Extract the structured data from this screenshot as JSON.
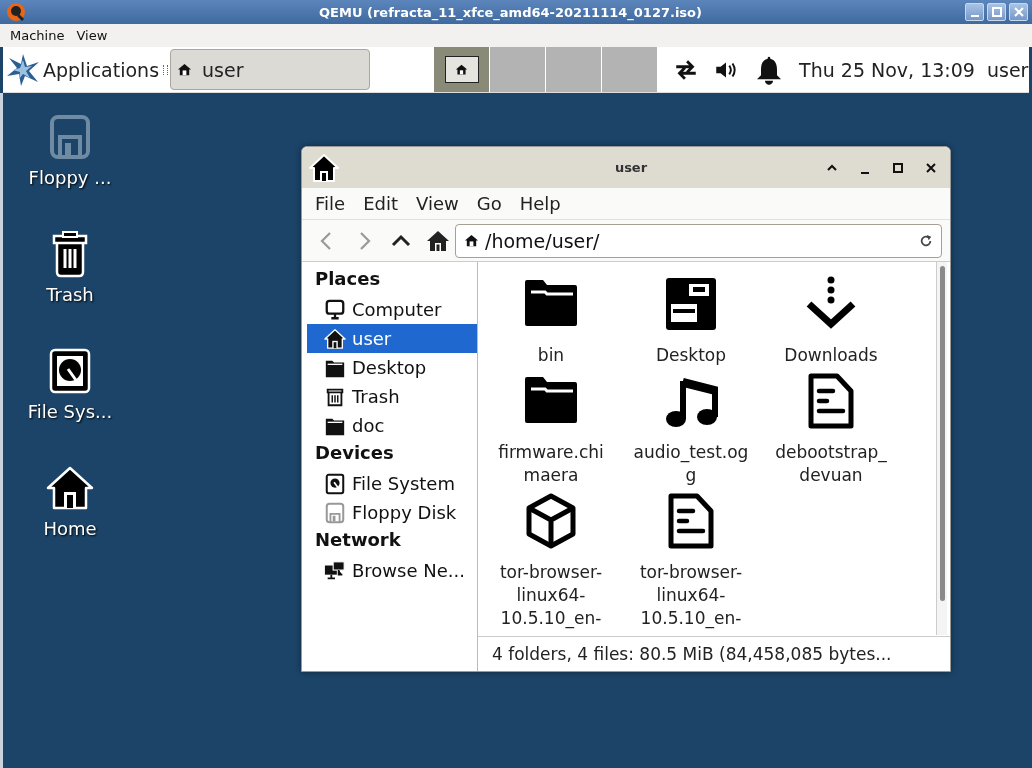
{
  "window": {
    "title": "QEMU (refracta_11_xfce_amd64-20211114_0127.iso)"
  },
  "menu": [
    "Machine",
    "View"
  ],
  "panel": {
    "applications": "Applications",
    "task": {
      "label": "user"
    },
    "workspaces": [
      {
        "selected": true
      },
      {
        "selected": false
      },
      {
        "selected": false
      },
      {
        "selected": false
      }
    ],
    "clock": "Thu 25 Nov, 13:09",
    "user": "user"
  },
  "desktop_icons": [
    {
      "kind": "floppy",
      "label": "Floppy ..."
    },
    {
      "kind": "trash",
      "label": "Trash"
    },
    {
      "kind": "drive",
      "label": "File Sys..."
    },
    {
      "kind": "home",
      "label": "Home"
    }
  ],
  "file_manager": {
    "title": "user",
    "menu": [
      "File",
      "Edit",
      "View",
      "Go",
      "Help"
    ],
    "location": "/home/user/",
    "sidebar": [
      {
        "heading": "Places",
        "items": [
          {
            "kind": "computer",
            "label": "Computer",
            "selected": false
          },
          {
            "kind": "home",
            "label": "user",
            "selected": true
          },
          {
            "kind": "folder",
            "label": "Desktop",
            "selected": false
          },
          {
            "kind": "trash",
            "label": "Trash",
            "selected": false
          },
          {
            "kind": "folder",
            "label": "doc",
            "selected": false
          }
        ]
      },
      {
        "heading": "Devices",
        "items": [
          {
            "kind": "drive",
            "label": "File System",
            "selected": false
          },
          {
            "kind": "floppy",
            "label": "Floppy Disk",
            "selected": false
          }
        ]
      },
      {
        "heading": "Network",
        "items": [
          {
            "kind": "network",
            "label": "Browse Ne...",
            "selected": false
          }
        ]
      }
    ],
    "files": [
      {
        "kind": "folder",
        "label": "bin"
      },
      {
        "kind": "desktop",
        "label": "Desktop"
      },
      {
        "kind": "download",
        "label": "Downloads"
      },
      {
        "kind": "folder",
        "label": "firmware.chimaera"
      },
      {
        "kind": "audio",
        "label": "audio_test.ogg"
      },
      {
        "kind": "document",
        "label": "debootstrap_devuan"
      },
      {
        "kind": "package",
        "label": "tor-browser-linux64-10.5.10_en-"
      },
      {
        "kind": "document",
        "label": "tor-browser-linux64-10.5.10_en-"
      }
    ],
    "status": "4 folders, 4 files: 80.5 MiB (84,458,085 bytes..."
  }
}
